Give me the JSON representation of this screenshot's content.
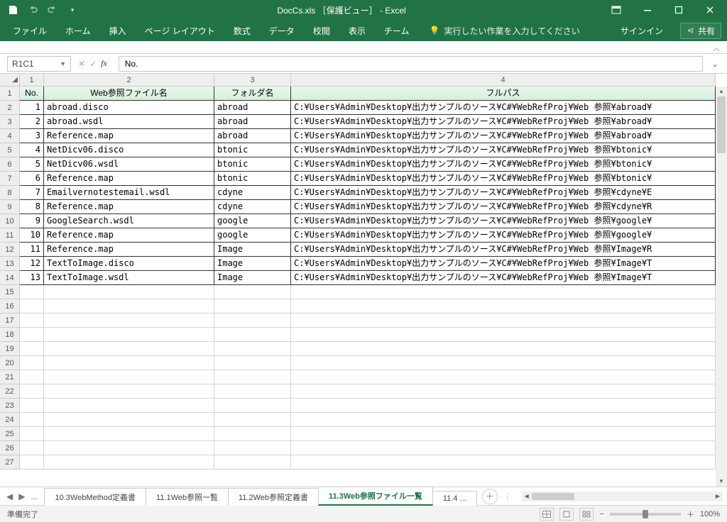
{
  "titlebar": {
    "title": "DocCs.xls ［保護ビュー］ - Excel"
  },
  "ribbon": {
    "tabs": [
      "ファイル",
      "ホーム",
      "挿入",
      "ページ レイアウト",
      "数式",
      "データ",
      "校閲",
      "表示",
      "チーム"
    ],
    "tell_me": "実行したい作業を入力してください",
    "signin": "サインイン",
    "share": "共有"
  },
  "name_box": "R1C1",
  "formula": "No.",
  "col_headers": [
    "1",
    "2",
    "3",
    "4"
  ],
  "table": {
    "headers": [
      "No.",
      "Web参照ファイル名",
      "フォルダ名",
      "フルパス"
    ],
    "rows": [
      {
        "no": 1,
        "fn": "abroad.disco",
        "fd": "abroad",
        "fp": "C:¥Users¥Admin¥Desktop¥出力サンプルのソース¥C#¥WebRefProj¥Web 参照¥abroad¥"
      },
      {
        "no": 2,
        "fn": "abroad.wsdl",
        "fd": "abroad",
        "fp": "C:¥Users¥Admin¥Desktop¥出力サンプルのソース¥C#¥WebRefProj¥Web 参照¥abroad¥"
      },
      {
        "no": 3,
        "fn": "Reference.map",
        "fd": "abroad",
        "fp": "C:¥Users¥Admin¥Desktop¥出力サンプルのソース¥C#¥WebRefProj¥Web 参照¥abroad¥"
      },
      {
        "no": 4,
        "fn": "NetDicv06.disco",
        "fd": "btonic",
        "fp": "C:¥Users¥Admin¥Desktop¥出力サンプルのソース¥C#¥WebRefProj¥Web 参照¥btonic¥"
      },
      {
        "no": 5,
        "fn": "NetDicv06.wsdl",
        "fd": "btonic",
        "fp": "C:¥Users¥Admin¥Desktop¥出力サンプルのソース¥C#¥WebRefProj¥Web 参照¥btonic¥"
      },
      {
        "no": 6,
        "fn": "Reference.map",
        "fd": "btonic",
        "fp": "C:¥Users¥Admin¥Desktop¥出力サンプルのソース¥C#¥WebRefProj¥Web 参照¥btonic¥"
      },
      {
        "no": 7,
        "fn": "Emailvernotestemail.wsdl",
        "fd": "cdyne",
        "fp": "C:¥Users¥Admin¥Desktop¥出力サンプルのソース¥C#¥WebRefProj¥Web 参照¥cdyne¥E"
      },
      {
        "no": 8,
        "fn": "Reference.map",
        "fd": "cdyne",
        "fp": "C:¥Users¥Admin¥Desktop¥出力サンプルのソース¥C#¥WebRefProj¥Web 参照¥cdyne¥R"
      },
      {
        "no": 9,
        "fn": "GoogleSearch.wsdl",
        "fd": "google",
        "fp": "C:¥Users¥Admin¥Desktop¥出力サンプルのソース¥C#¥WebRefProj¥Web 参照¥google¥"
      },
      {
        "no": 10,
        "fn": "Reference.map",
        "fd": "google",
        "fp": "C:¥Users¥Admin¥Desktop¥出力サンプルのソース¥C#¥WebRefProj¥Web 参照¥google¥"
      },
      {
        "no": 11,
        "fn": "Reference.map",
        "fd": "Image",
        "fp": "C:¥Users¥Admin¥Desktop¥出力サンプルのソース¥C#¥WebRefProj¥Web 参照¥Image¥R"
      },
      {
        "no": 12,
        "fn": "TextToImage.disco",
        "fd": "Image",
        "fp": "C:¥Users¥Admin¥Desktop¥出力サンプルのソース¥C#¥WebRefProj¥Web 参照¥Image¥T"
      },
      {
        "no": 13,
        "fn": "TextToImage.wsdl",
        "fd": "Image",
        "fp": "C:¥Users¥Admin¥Desktop¥出力サンプルのソース¥C#¥WebRefProj¥Web 参照¥Image¥T"
      }
    ]
  },
  "sheet_tabs": {
    "ellipsis_left": "...",
    "tabs": [
      "10.3WebMethod定義書",
      "11.1Web参照一覧",
      "11.2Web参照定義書",
      "11.3Web参照ファイル一覧",
      "11.4 ..."
    ],
    "active_index": 3
  },
  "status": {
    "ready": "準備完了",
    "zoom": "100%"
  },
  "row_count": 27
}
